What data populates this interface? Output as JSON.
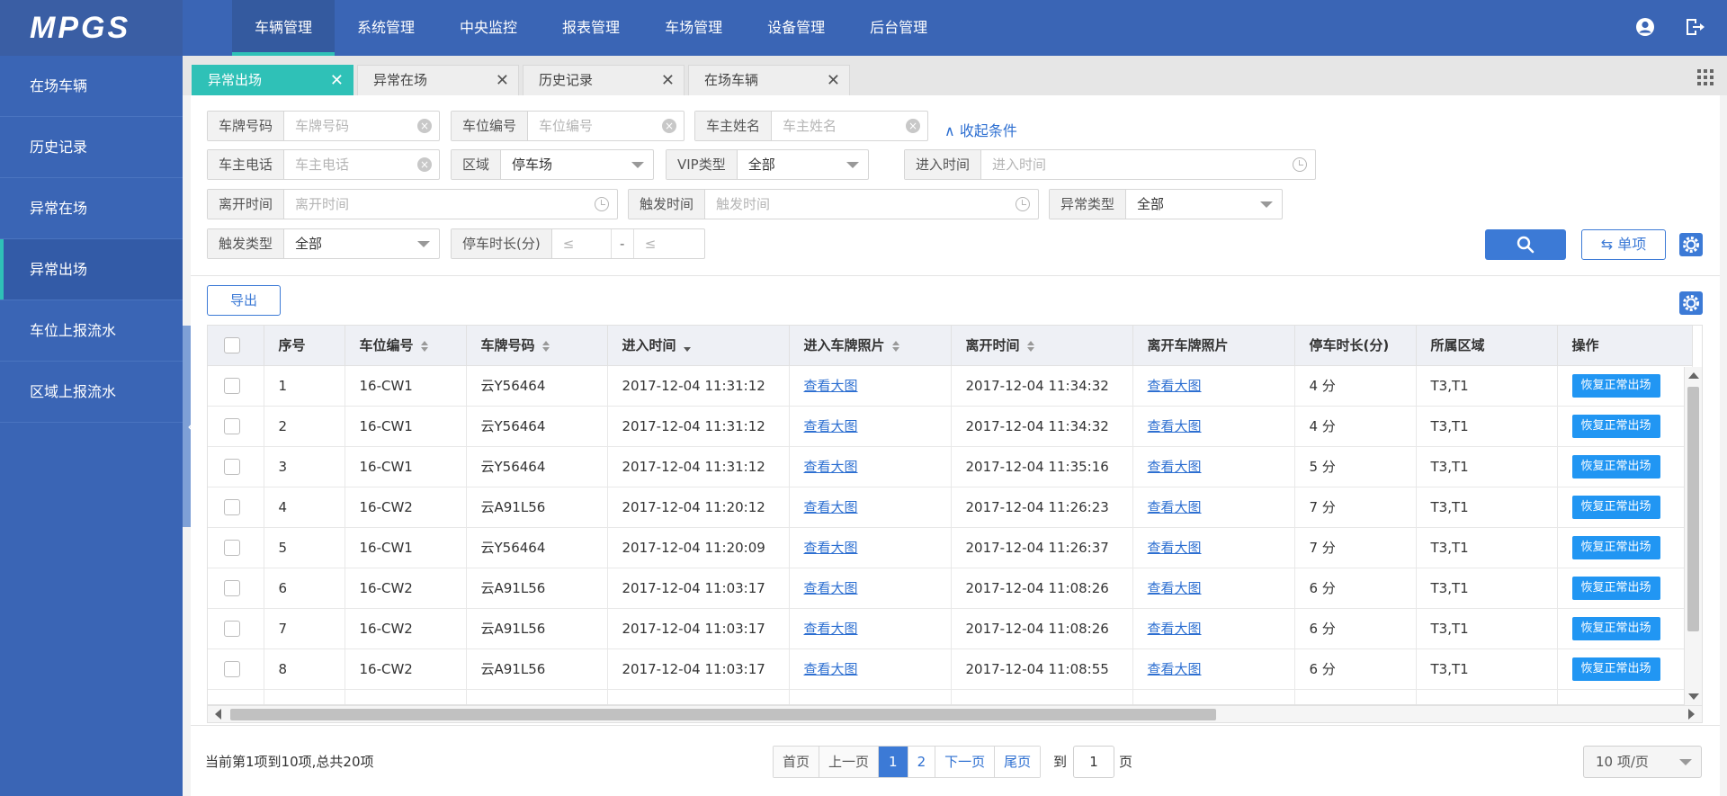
{
  "app": {
    "logo": "MPGS"
  },
  "nav": {
    "items": [
      {
        "label": "车辆管理",
        "active": true
      },
      {
        "label": "系统管理"
      },
      {
        "label": "中央监控"
      },
      {
        "label": "报表管理"
      },
      {
        "label": "车场管理"
      },
      {
        "label": "设备管理"
      },
      {
        "label": "后台管理"
      }
    ]
  },
  "sidebar": {
    "items": [
      {
        "label": "在场车辆"
      },
      {
        "label": "历史记录"
      },
      {
        "label": "异常在场"
      },
      {
        "label": "异常出场",
        "active": true
      },
      {
        "label": "车位上报流水"
      },
      {
        "label": "区域上报流水"
      }
    ]
  },
  "tabs": [
    {
      "label": "异常出场",
      "active": true
    },
    {
      "label": "异常在场"
    },
    {
      "label": "历史记录"
    },
    {
      "label": "在场车辆"
    }
  ],
  "filters": {
    "plate": {
      "label": "车牌号码",
      "placeholder": "车牌号码"
    },
    "space": {
      "label": "车位编号",
      "placeholder": "车位编号"
    },
    "owner": {
      "label": "车主姓名",
      "placeholder": "车主姓名"
    },
    "collapse": "收起条件",
    "phone": {
      "label": "车主电话",
      "placeholder": "车主电话"
    },
    "area": {
      "label": "区域",
      "value": "停车场"
    },
    "vip": {
      "label": "VIP类型",
      "value": "全部"
    },
    "entry_time": {
      "label": "进入时间",
      "placeholder": "进入时间"
    },
    "exit_time": {
      "label": "离开时间",
      "placeholder": "离开时间"
    },
    "trigger_time": {
      "label": "触发时间",
      "placeholder": "触发时间"
    },
    "abnormal_type": {
      "label": "异常类型",
      "value": "全部"
    },
    "trigger_type": {
      "label": "触发类型",
      "value": "全部"
    },
    "duration": {
      "label": "停车时长(分)",
      "min_ph": "≤",
      "sep": "-",
      "max_ph": "≤"
    }
  },
  "actions": {
    "single": "单项",
    "export": "导出"
  },
  "table": {
    "headers": [
      "序号",
      "车位编号",
      "车牌号码",
      "进入时间",
      "进入车牌照片",
      "离开时间",
      "离开车牌照片",
      "停车时长(分)",
      "所属区域",
      "操作"
    ],
    "rows": [
      {
        "no": "1",
        "space": "16-CW1",
        "plate": "云Y56464",
        "in": "2017-12-04 11:31:12",
        "in_photo": "查看大图",
        "out": "2017-12-04 11:34:32",
        "out_photo": "查看大图",
        "dur": "4 分",
        "area": "T3,T1",
        "op": "恢复正常出场"
      },
      {
        "no": "2",
        "space": "16-CW1",
        "plate": "云Y56464",
        "in": "2017-12-04 11:31:12",
        "in_photo": "查看大图",
        "out": "2017-12-04 11:34:32",
        "out_photo": "查看大图",
        "dur": "4 分",
        "area": "T3,T1",
        "op": "恢复正常出场"
      },
      {
        "no": "3",
        "space": "16-CW1",
        "plate": "云Y56464",
        "in": "2017-12-04 11:31:12",
        "in_photo": "查看大图",
        "out": "2017-12-04 11:35:16",
        "out_photo": "查看大图",
        "dur": "5 分",
        "area": "T3,T1",
        "op": "恢复正常出场"
      },
      {
        "no": "4",
        "space": "16-CW2",
        "plate": "云A91L56",
        "in": "2017-12-04 11:20:12",
        "in_photo": "查看大图",
        "out": "2017-12-04 11:26:23",
        "out_photo": "查看大图",
        "dur": "7 分",
        "area": "T3,T1",
        "op": "恢复正常出场"
      },
      {
        "no": "5",
        "space": "16-CW1",
        "plate": "云Y56464",
        "in": "2017-12-04 11:20:09",
        "in_photo": "查看大图",
        "out": "2017-12-04 11:26:37",
        "out_photo": "查看大图",
        "dur": "7 分",
        "area": "T3,T1",
        "op": "恢复正常出场"
      },
      {
        "no": "6",
        "space": "16-CW2",
        "plate": "云A91L56",
        "in": "2017-12-04 11:03:17",
        "in_photo": "查看大图",
        "out": "2017-12-04 11:08:26",
        "out_photo": "查看大图",
        "dur": "6 分",
        "area": "T3,T1",
        "op": "恢复正常出场"
      },
      {
        "no": "7",
        "space": "16-CW2",
        "plate": "云A91L56",
        "in": "2017-12-04 11:03:17",
        "in_photo": "查看大图",
        "out": "2017-12-04 11:08:26",
        "out_photo": "查看大图",
        "dur": "6 分",
        "area": "T3,T1",
        "op": "恢复正常出场"
      },
      {
        "no": "8",
        "space": "16-CW2",
        "plate": "云A91L56",
        "in": "2017-12-04 11:03:17",
        "in_photo": "查看大图",
        "out": "2017-12-04 11:08:55",
        "out_photo": "查看大图",
        "dur": "6 分",
        "area": "T3,T1",
        "op": "恢复正常出场"
      }
    ]
  },
  "pagination": {
    "summary": "当前第1项到10项,总共20项",
    "first": "首页",
    "prev": "上一页",
    "pages": [
      "1",
      "2"
    ],
    "next": "下一页",
    "last": "尾页",
    "goto_prefix": "到",
    "goto_value": "1",
    "goto_suffix": "页",
    "page_size": "10 项/页"
  },
  "colors": {
    "primary": "#3a65b5",
    "accent": "#2fc1b7",
    "button": "#3c7ad6",
    "op_button": "#2196f3"
  }
}
